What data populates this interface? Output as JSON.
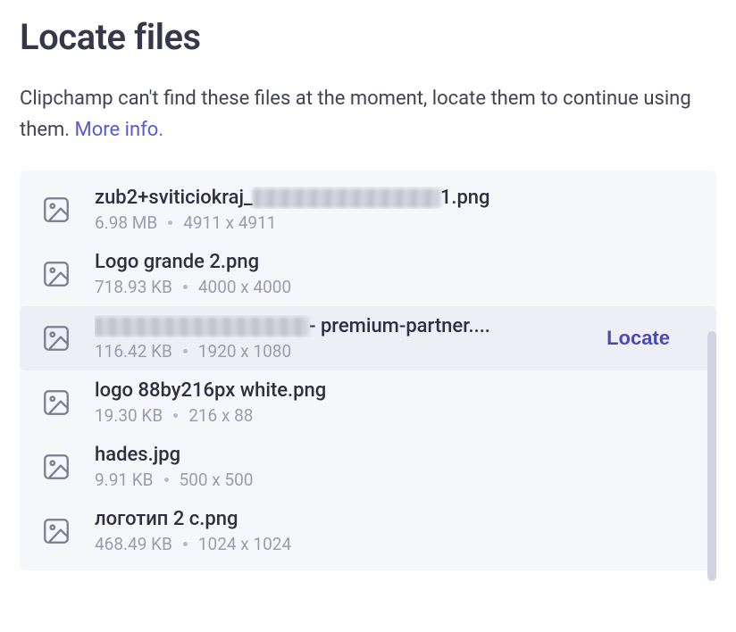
{
  "header": {
    "title": "Locate files"
  },
  "description": {
    "text_part1": "Clipchamp can't find these files at the moment, locate them to continue using them. ",
    "more_link": "More info."
  },
  "locate_button_label": "Locate",
  "files": [
    {
      "name_prefix": "zub2+sviticiokraj_",
      "name_redacted_width": 210,
      "name_suffix": " 1.png",
      "size": "6.98 MB",
      "dimensions": "4911 x 4911",
      "hovered": false
    },
    {
      "name_prefix": "Logo grande 2.png",
      "name_redacted_width": 0,
      "name_suffix": "",
      "size": "718.93 KB",
      "dimensions": "4000 x 4000",
      "hovered": false
    },
    {
      "name_prefix": "",
      "name_redacted_width": 240,
      "name_suffix": " - premium-partner....",
      "size": "116.42 KB",
      "dimensions": "1920 x 1080",
      "hovered": true
    },
    {
      "name_prefix": "logo 88by216px white.png",
      "name_redacted_width": 0,
      "name_suffix": "",
      "size": "19.30 KB",
      "dimensions": "216 x 88",
      "hovered": false
    },
    {
      "name_prefix": "hades.jpg",
      "name_redacted_width": 0,
      "name_suffix": "",
      "size": "9.91 KB",
      "dimensions": "500 x 500",
      "hovered": false
    },
    {
      "name_prefix": "логотип 2 c.png",
      "name_redacted_width": 0,
      "name_suffix": "",
      "size": "468.49 KB",
      "dimensions": "1024 x 1024",
      "hovered": false
    }
  ]
}
